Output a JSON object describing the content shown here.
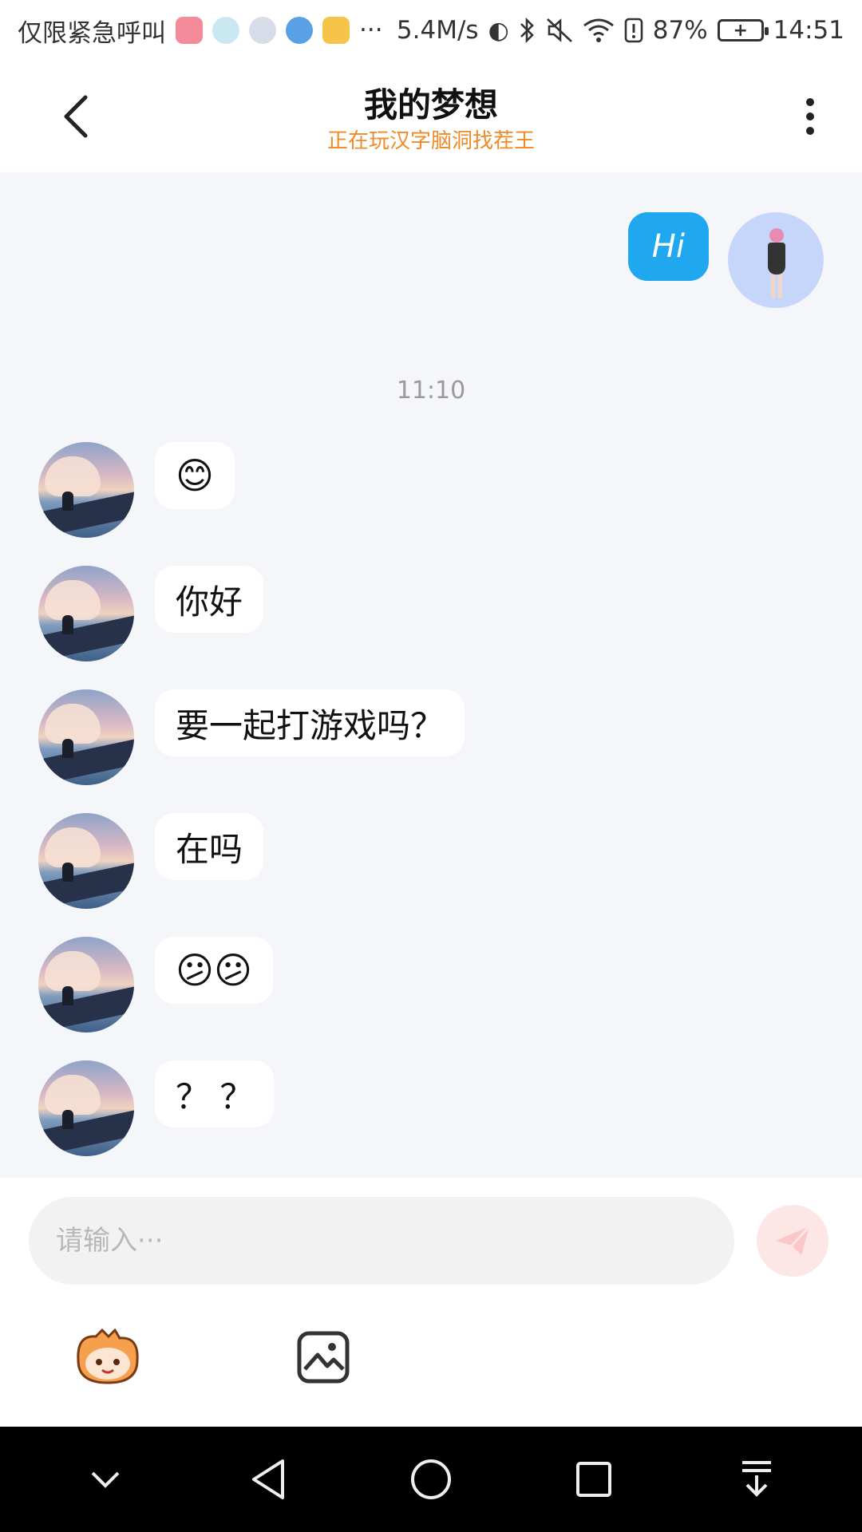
{
  "status_bar": {
    "carrier_text": "仅限紧急呼叫",
    "more_notifications": "···",
    "net_speed": "5.4M/s",
    "battery_percent": "87%",
    "time": "14:51"
  },
  "header": {
    "title": "我的梦想",
    "subtitle": "正在玩汉字脑洞找茬王"
  },
  "chat": {
    "my_message": "Hi",
    "timestamp": "11:10",
    "messages": [
      {
        "text": "😊"
      },
      {
        "text": "你好"
      },
      {
        "text": "要一起打游戏吗？"
      },
      {
        "text": "在吗"
      },
      {
        "text": "😕😕"
      },
      {
        "text": "？ ？"
      }
    ]
  },
  "composer": {
    "placeholder": "请输入···"
  },
  "icons": {
    "back": "back-arrow-icon",
    "more": "more-vertical-icon",
    "send": "send-icon",
    "emoji_sticker": "mascot-sticker-icon",
    "image": "image-icon",
    "nav_collapse": "chevron-down-icon",
    "nav_back": "triangle-back-icon",
    "nav_home": "circle-home-icon",
    "nav_recents": "square-recents-icon",
    "nav_notifications": "pull-down-icon"
  },
  "colors": {
    "my_bubble": "#1fa8f0",
    "subtitle": "#f08a24",
    "send_button": "#fde6e6",
    "chat_background": "#f4f6f9"
  }
}
